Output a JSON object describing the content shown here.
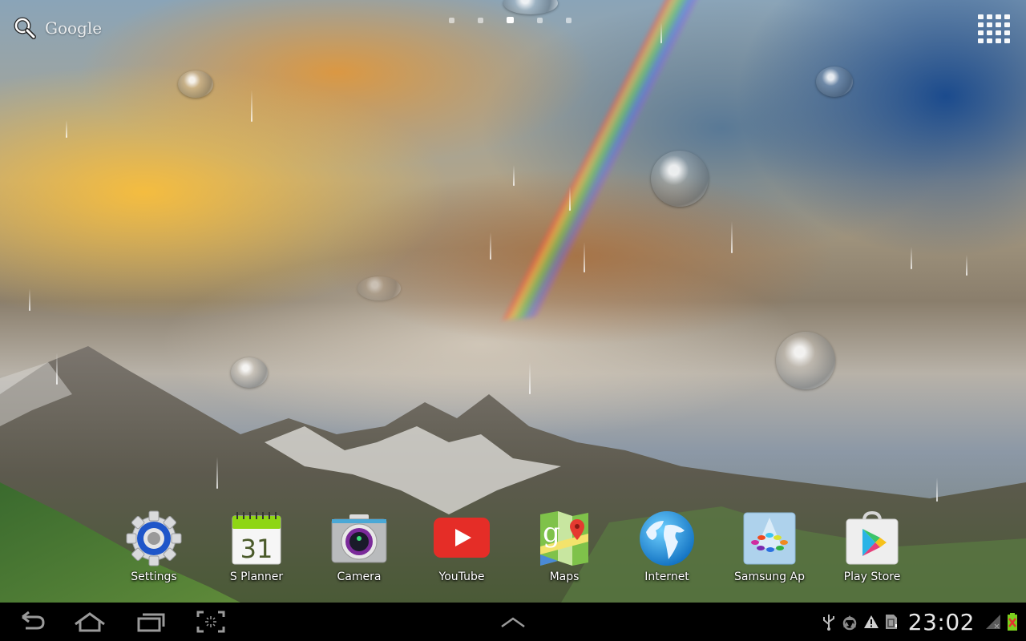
{
  "top_bar": {
    "search_label": "Google",
    "page_indicator": {
      "count": 5,
      "active_index": 2
    }
  },
  "dock": {
    "apps": [
      {
        "label": "Settings",
        "icon": "settings-gear-icon"
      },
      {
        "label": "S Planner",
        "icon": "calendar-icon",
        "calendar_day": "31"
      },
      {
        "label": "Camera",
        "icon": "camera-icon"
      },
      {
        "label": "YouTube",
        "icon": "youtube-icon"
      },
      {
        "label": "Maps",
        "icon": "maps-icon"
      },
      {
        "label": "Internet",
        "icon": "globe-icon"
      },
      {
        "label": "Samsung Ap",
        "icon": "samsung-apps-icon"
      },
      {
        "label": "Play Store",
        "icon": "play-store-icon"
      }
    ]
  },
  "navbar": {
    "buttons": [
      "back",
      "home",
      "recent-apps",
      "screenshot"
    ],
    "clock": "23:02",
    "status_icons": [
      "usb-icon",
      "recycle-icon",
      "warning-icon",
      "sd-card-icon",
      "no-signal-icon",
      "battery-error-icon"
    ]
  },
  "colors": {
    "navbar_bg": "#000000",
    "youtube_red": "#e52d27",
    "planner_green": "#8ed614",
    "settings_blue": "#1f56c9",
    "battery_green": "#7ccf1e",
    "battery_x": "#e53030"
  }
}
